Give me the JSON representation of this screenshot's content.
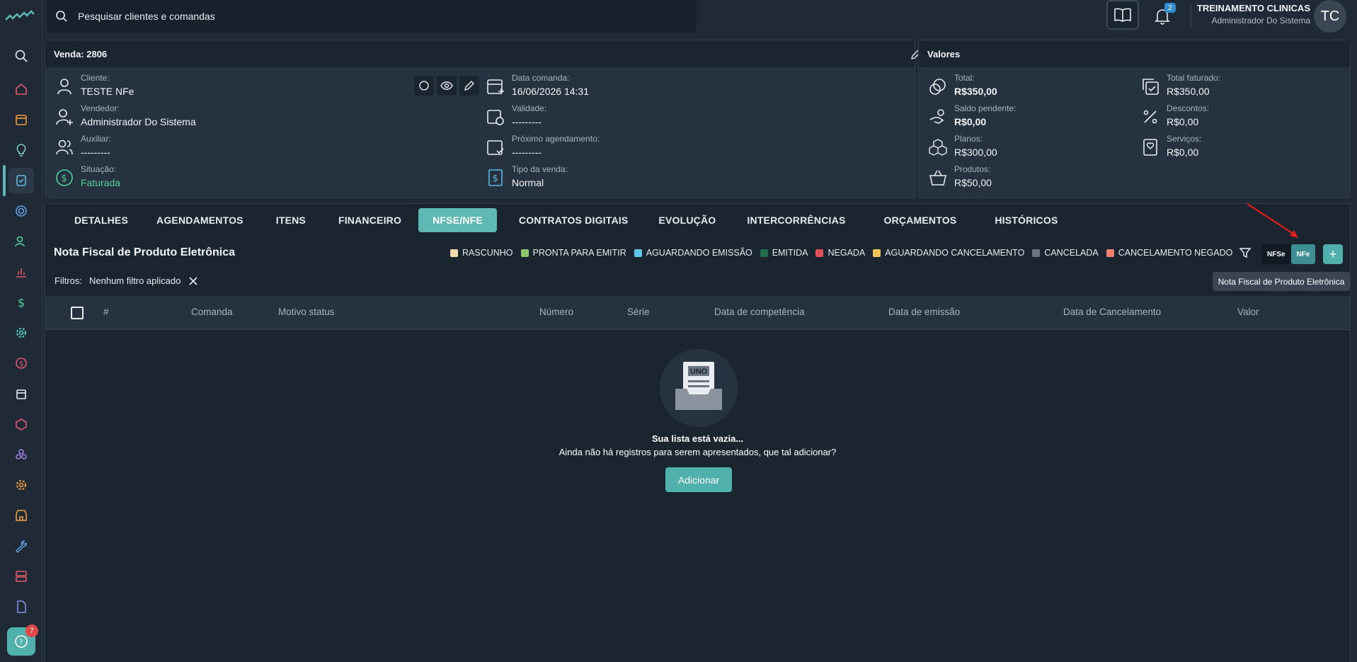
{
  "search": {
    "placeholder": "Pesquisar clientes e comandas"
  },
  "notifications": {
    "count": "2"
  },
  "user": {
    "company": "TREINAMENTO CLINICAS",
    "role": "Administrador Do Sistema",
    "initials": "TC"
  },
  "help": {
    "badge": "7"
  },
  "sale": {
    "title": "Venda: 2806",
    "client_label": "Cliente:",
    "client": "TESTE NFe",
    "seller_label": "Vendedor:",
    "seller": "Administrador Do Sistema",
    "assistant_label": "Auxiliar:",
    "assistant": "---------",
    "status_label": "Situação:",
    "status": "Faturada",
    "date_label": "Data comanda:",
    "date": "16/06/2026 14:31",
    "validity_label": "Validade:",
    "validity": "---------",
    "next_label": "Próximo agendamento:",
    "next": "---------",
    "type_label": "Tipo da venda:",
    "type": "Normal"
  },
  "values": {
    "title": "Valores",
    "total_label": "Total:",
    "total": "R$350,00",
    "pending_label": "Saldo pendente:",
    "pending": "R$0,00",
    "plans_label": "Planos:",
    "plans": "R$300,00",
    "products_label": "Produtos:",
    "products": "R$50,00",
    "billed_label": "Total faturado:",
    "billed": "R$350,00",
    "discounts_label": "Descontos:",
    "discounts": "R$0,00",
    "services_label": "Serviços:",
    "services": "R$0,00"
  },
  "tabs": [
    "DETALHES",
    "AGENDAMENTOS",
    "ITENS",
    "FINANCEIRO",
    "NFSE/NFE",
    "CONTRATOS DIGITAIS",
    "EVOLUÇÃO",
    "INTERCORRÊNCIAS",
    "ORÇAMENTOS",
    "HISTÓRICOS"
  ],
  "section": {
    "title": "Nota Fiscal de Produto Eletrônica"
  },
  "legend": [
    {
      "label": "RASCUNHO",
      "color": "#f2dcb0"
    },
    {
      "label": "PRONTA PARA EMITIR",
      "color": "#8cc56a"
    },
    {
      "label": "AGUARDANDO EMISSÃO",
      "color": "#5fc6e8"
    },
    {
      "label": "EMITIDA",
      "color": "#1f6e4e"
    },
    {
      "label": "NEGADA",
      "color": "#e0505a"
    },
    {
      "label": "AGUARDANDO CANCELAMENTO",
      "color": "#f2c45a"
    },
    {
      "label": "CANCELADA",
      "color": "#6b7480"
    },
    {
      "label": "CANCELAMENTO NEGADO",
      "color": "#f08070"
    }
  ],
  "toggle": {
    "nfse": "NFSe",
    "nfe": "NFe"
  },
  "tooltip": "Nota Fiscal de Produto Eletrônica",
  "filters": {
    "label": "Filtros:",
    "value": "Nenhum filtro aplicado"
  },
  "table": {
    "columns": [
      "#",
      "Comanda",
      "Motivo status",
      "Número",
      "Série",
      "Data de competência",
      "Data de emissão",
      "Data de Cancelamento",
      "Valor"
    ]
  },
  "empty": {
    "logo_text": "UNO",
    "title": "Sua lista está vazia...",
    "subtitle": "Ainda não há registros para serem apresentados, que tal adicionar?",
    "button": "Adicionar"
  }
}
